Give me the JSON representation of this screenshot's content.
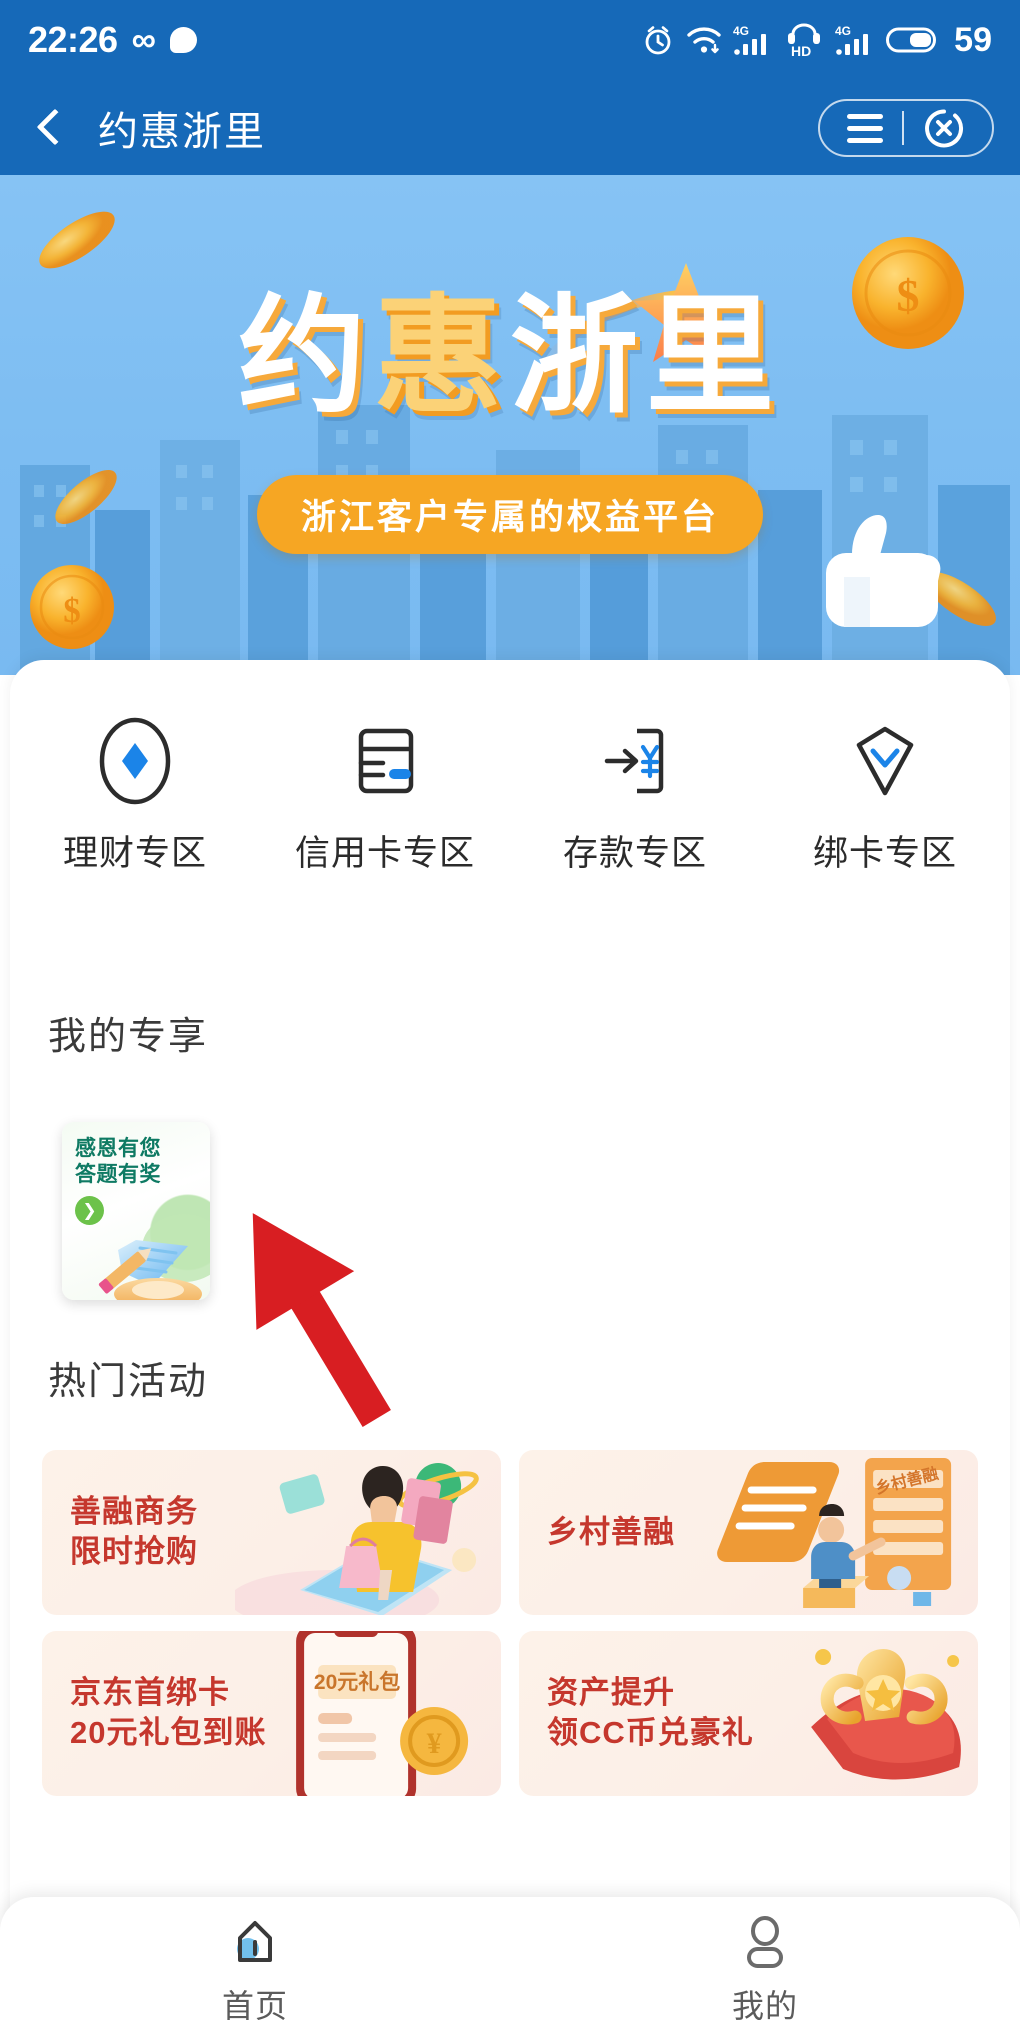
{
  "status_bar": {
    "time": "22:26",
    "infinity_glyph": "∞",
    "battery_level": "59",
    "icons": [
      "infinity-icon",
      "chat-bubble-icon",
      "alarm-icon",
      "wifi-icon",
      "signal-4g-icon",
      "hd-icon",
      "signal-4g-secondary-icon",
      "battery-icon"
    ]
  },
  "header": {
    "title": "约惠浙里",
    "back_label": "",
    "menu_label": "",
    "close_label": ""
  },
  "banner": {
    "title_part1": "约",
    "title_part2": "惠",
    "title_part3": "浙",
    "title_part4": "里",
    "subtitle": "浙江客户专属的权益平台"
  },
  "quick_links": {
    "items": [
      {
        "label": "理财专区",
        "icon": "finance-diamond-icon"
      },
      {
        "label": "信用卡专区",
        "icon": "credit-card-icon"
      },
      {
        "label": "存款专区",
        "icon": "deposit-yen-icon"
      },
      {
        "label": "绑卡专区",
        "icon": "bind-card-diamond-icon"
      }
    ]
  },
  "my_exclusive": {
    "title": "我的专享",
    "card": {
      "line1": "感恩有您",
      "line2": "答题有奖",
      "arrow_glyph": "❯",
      "accent_color": "#0E7A63"
    }
  },
  "hot_activities": {
    "title": "热门活动",
    "items": [
      {
        "line1": "善融商务",
        "line2": "限时抢购",
        "art": "shopping-woman-art"
      },
      {
        "line1": "乡村善融",
        "line2": "",
        "art": "village-finance-art"
      },
      {
        "line1": "京东首绑卡",
        "line2": "20元礼包到账",
        "art": "phone-gift-art",
        "badge": "20元礼包"
      },
      {
        "line1": "资产提升",
        "line2": "领CC币兑豪礼",
        "art": "gift-ribbon-art"
      }
    ]
  },
  "bottom_nav": {
    "items": [
      {
        "label": "首页",
        "icon": "home-icon",
        "active": true
      },
      {
        "label": "我的",
        "icon": "user-icon",
        "active": false
      }
    ]
  },
  "annotation": {
    "arrow_color": "#D81E22",
    "type": "pointer-arrow"
  },
  "colors": {
    "header_blue": "#1669B8",
    "banner_sky": "#7FC0F5",
    "banner_gold": "#F6A623",
    "card_red": "#C5372D",
    "card_bg": "#FDF2E9",
    "nav_active": "#5BB4E8"
  }
}
